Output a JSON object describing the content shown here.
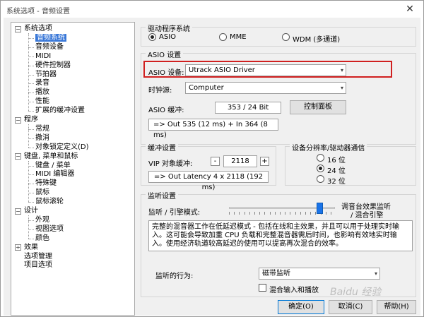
{
  "window": {
    "title": "系统选项 - 音频设置",
    "close_glyph": "✕"
  },
  "tree": {
    "items": [
      {
        "label": "系统选项",
        "expander": "−"
      },
      {
        "label": "音频系统"
      },
      {
        "label": "音频设备"
      },
      {
        "label": "MIDI"
      },
      {
        "label": "硬件控制器"
      },
      {
        "label": "节拍器"
      },
      {
        "label": "录音"
      },
      {
        "label": "播放"
      },
      {
        "label": "性能"
      },
      {
        "label": "扩展的缓冲设置"
      },
      {
        "label": "程序",
        "expander": "−"
      },
      {
        "label": "常规"
      },
      {
        "label": "撤消"
      },
      {
        "label": "对象锁定定义(D)"
      },
      {
        "label": "键盘, 菜单和鼠标",
        "expander": "−"
      },
      {
        "label": "键盘 / 菜单"
      },
      {
        "label": "MIDI 编辑器"
      },
      {
        "label": "特殊键"
      },
      {
        "label": "鼠标"
      },
      {
        "label": "鼠标滚轮"
      },
      {
        "label": "设计",
        "expander": "−"
      },
      {
        "label": "外观"
      },
      {
        "label": "视图选项"
      },
      {
        "label": "颜色"
      },
      {
        "label": "效果",
        "expander": "+"
      },
      {
        "label": "选项管理"
      },
      {
        "label": "项目选项"
      }
    ]
  },
  "driver_system": {
    "legend": "驱动程序系统",
    "options": [
      {
        "label": "ASIO",
        "selected": true
      },
      {
        "label": "MME",
        "selected": false
      },
      {
        "label": "WDM (多通道)",
        "selected": false
      }
    ]
  },
  "asio": {
    "legend": "ASIO 设置",
    "device_label": "ASIO 设备:",
    "device_value": "Utrack ASIO Driver",
    "clock_label": "时钟源:",
    "clock_value": "Computer",
    "buffer_label": "ASIO 缓冲:",
    "buffer_value": "353 / 24 Bit",
    "control_panel_button": "控制面板",
    "latency_text": "=> Out 535 (12 ms) + In 364 (8 ms)"
  },
  "buffer": {
    "legend": "缓冲设置",
    "vip_label": "VIP 对象缓冲:",
    "minus": "-",
    "plus": "+",
    "value": "2118",
    "latency_text": "=> Out Latency 4 x 2118 (192 ms)"
  },
  "resolution": {
    "legend": "设备分辨率/驱动器通信",
    "options": [
      {
        "label": "16 位",
        "selected": false
      },
      {
        "label": "24 位",
        "selected": true
      },
      {
        "label": "32 位",
        "selected": false
      }
    ]
  },
  "monitor": {
    "legend": "监听设置",
    "mode_label": "监听 / 引擎模式:",
    "right_label_1": "调音台效果监听",
    "right_label_2": "/ 混合引擎",
    "slider_position": 0.86,
    "description": "完整的混音器工作在低延迟模式 - 包括在线和主效果，并且可以用于处理实时输入。这可能会导致加重 CPU 负载和完整混音器需后时间，也影响有效地实时输入。使用经济轨道较高延迟的使用可以提高再次混合的效率。",
    "behavior_label": "监听的行为:",
    "behavior_value": "磁带监听",
    "mix_input_label": "混合输入和播放",
    "mix_input_checked": false
  },
  "buttons": {
    "ok": "确定(O)",
    "cancel": "取消(C)",
    "help": "帮助(H)"
  },
  "watermark": "Baidu 经验"
}
